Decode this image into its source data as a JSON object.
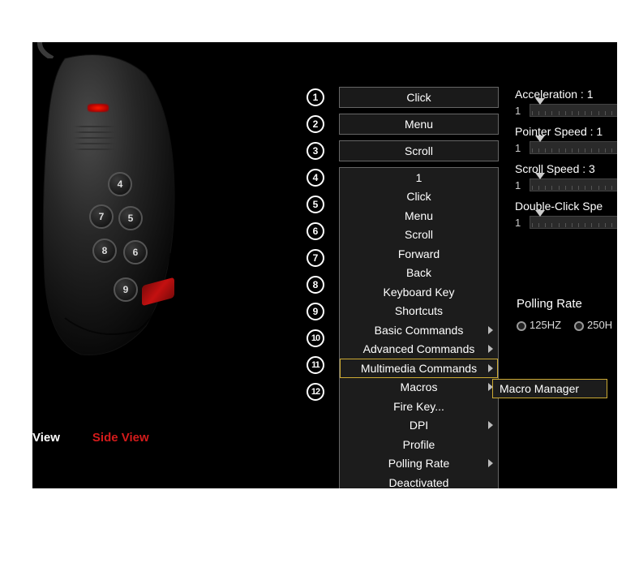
{
  "viewTabs": {
    "front": "View",
    "side": "Side View"
  },
  "buttons": [
    {
      "num": "1",
      "label": "Click"
    },
    {
      "num": "2",
      "label": "Menu"
    },
    {
      "num": "3",
      "label": "Scroll"
    },
    {
      "num": "4",
      "label": ""
    },
    {
      "num": "5",
      "label": ""
    },
    {
      "num": "6",
      "label": ""
    },
    {
      "num": "7",
      "label": ""
    },
    {
      "num": "8",
      "label": ""
    },
    {
      "num": "9",
      "label": ""
    },
    {
      "num": "10",
      "label": ""
    },
    {
      "num": "11",
      "label": ""
    },
    {
      "num": "12",
      "label": ""
    }
  ],
  "dropdown": {
    "items": [
      {
        "label": "1",
        "arrow": false
      },
      {
        "label": "Click",
        "arrow": false
      },
      {
        "label": "Menu",
        "arrow": false
      },
      {
        "label": "Scroll",
        "arrow": false
      },
      {
        "label": "Forward",
        "arrow": false
      },
      {
        "label": "Back",
        "arrow": false
      },
      {
        "label": "Keyboard Key",
        "arrow": false
      },
      {
        "label": "Shortcuts",
        "arrow": false
      },
      {
        "label": "Basic Commands",
        "arrow": true
      },
      {
        "label": "Advanced Commands",
        "arrow": true
      },
      {
        "label": "Multimedia Commands",
        "arrow": true,
        "highlight": true
      },
      {
        "label": "Macros",
        "arrow": true
      },
      {
        "label": "Fire Key...",
        "arrow": false
      },
      {
        "label": "DPI",
        "arrow": true
      },
      {
        "label": "Profile",
        "arrow": false
      },
      {
        "label": "Polling Rate",
        "arrow": true
      },
      {
        "label": "Deactivated",
        "arrow": false
      }
    ],
    "submenu": "Macro Manager"
  },
  "sliders": [
    {
      "label": "Acceleration : 1",
      "min": "1",
      "pos": 4
    },
    {
      "label": "Pointer Speed : 1",
      "min": "1",
      "pos": 4
    },
    {
      "label": "Scroll Speed : 3",
      "min": "1",
      "pos": 4
    },
    {
      "label": "Double-Click Spe",
      "min": "1",
      "pos": 4
    }
  ],
  "polling": {
    "title": "Polling Rate",
    "opts": [
      "125HZ",
      "250H"
    ]
  },
  "sideButtons": [
    "4",
    "5",
    "6",
    "7",
    "8",
    "9"
  ]
}
